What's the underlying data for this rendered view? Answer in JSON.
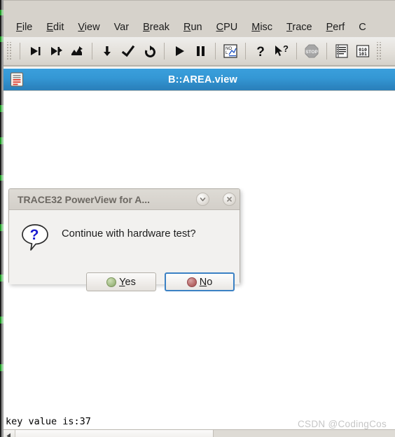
{
  "app": {
    "window_background": "#d6d2cb",
    "accent": "#3497d4"
  },
  "menubar": {
    "items": [
      {
        "label": "File",
        "accel": "F"
      },
      {
        "label": "Edit",
        "accel": "E"
      },
      {
        "label": "View",
        "accel": "V"
      },
      {
        "label": "Var",
        "accel": ""
      },
      {
        "label": "Break",
        "accel": "B"
      },
      {
        "label": "Run",
        "accel": "R"
      },
      {
        "label": "CPU",
        "accel": "C"
      },
      {
        "label": "Misc",
        "accel": "M"
      },
      {
        "label": "Trace",
        "accel": "T"
      },
      {
        "label": "Perf",
        "accel": "P"
      },
      {
        "label": "C",
        "accel": ""
      }
    ]
  },
  "toolbar": {
    "buttons": [
      {
        "icon": "step-into-icon",
        "title": "Step"
      },
      {
        "icon": "step-over-icon",
        "title": "Step Over"
      },
      {
        "icon": "step-out-icon",
        "title": "Step Out"
      },
      {
        "icon": "step-down-icon",
        "title": "Step Down"
      },
      {
        "icon": "step-return-icon",
        "title": "Return"
      },
      {
        "icon": "step-back-icon",
        "title": "Go Back"
      },
      {
        "icon": "run-icon",
        "title": "Go"
      },
      {
        "icon": "break-icon",
        "title": "Break"
      },
      {
        "icon": "trace-chart-icon",
        "title": "Trace Chart"
      },
      {
        "icon": "help-icon",
        "title": "Help"
      },
      {
        "icon": "context-help-icon",
        "title": "Context Help"
      },
      {
        "icon": "stop-icon",
        "title": "Stop"
      },
      {
        "icon": "list-icon",
        "title": "List Source"
      },
      {
        "icon": "binary-data-icon",
        "title": "Data Dump"
      }
    ]
  },
  "child_window": {
    "icon": "document-view-icon",
    "title": "B::AREA.view",
    "status_line": "key value is:37",
    "scrollbar": {
      "left_arrow_icon": "triangle-left-icon",
      "thumb_fraction": 0.52
    }
  },
  "dialog": {
    "title": "TRACE32 PowerView for A...",
    "collapse_icon": "chevron-down-icon",
    "close_icon": "close-icon",
    "question_icon": "question-bubble-icon",
    "message": "Continue with hardware test?",
    "buttons": [
      {
        "label_pre": "",
        "accel": "Y",
        "label_post": "es",
        "dot_color": "#8fae70",
        "focused": false,
        "name": "yes"
      },
      {
        "label_pre": "",
        "accel": "N",
        "label_post": "o",
        "dot_color": "#a85b5b",
        "focused": true,
        "name": "no"
      }
    ],
    "yes_label_accel": "Y",
    "yes_label_rest": "es",
    "no_label_accel": "N",
    "no_label_rest": "o"
  },
  "watermark": {
    "text": "CSDN @CodingCos"
  }
}
